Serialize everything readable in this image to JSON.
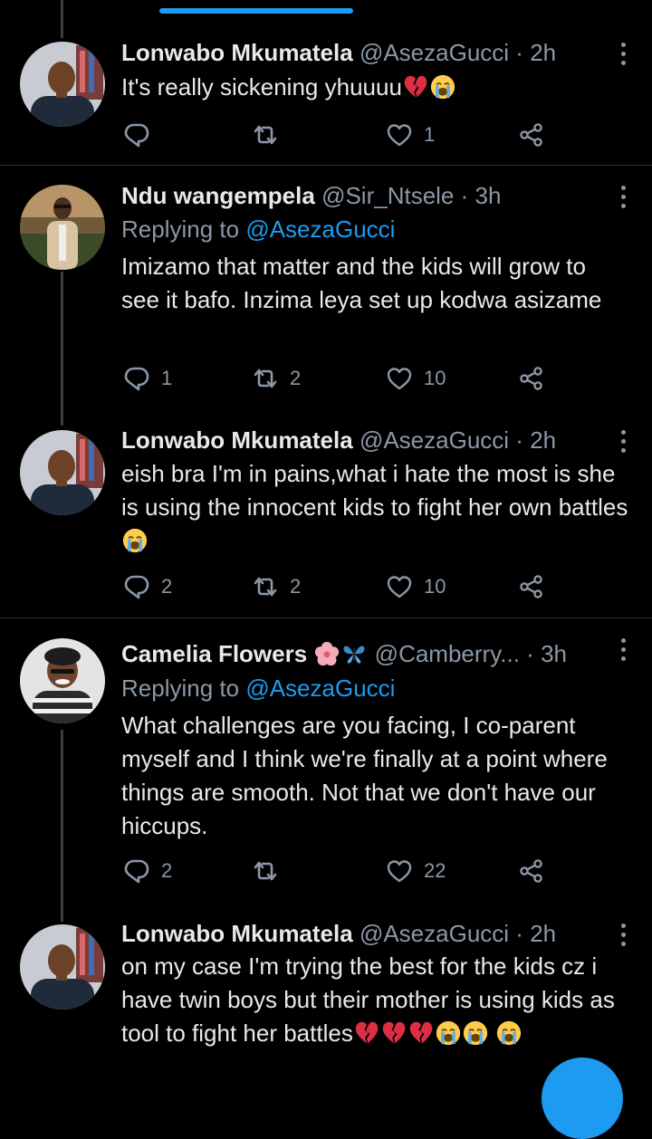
{
  "colors": {
    "background": "#000000",
    "text": "#e7e9ea",
    "secondary": "#8b98a5",
    "accent": "#1d9bf0",
    "divider": "#2f3336"
  },
  "tweets": [
    {
      "name": "Lonwabo Mkumatela",
      "handle": "@AsezaGucci",
      "separator": "·",
      "time": "2h",
      "replying_label": "",
      "replying_to": "",
      "text": "It's really sickening yhuuuu",
      "emojis": [
        "broken-heart",
        "crying-face"
      ],
      "replies": "",
      "retweets": "",
      "likes": "1"
    },
    {
      "name": "Ndu wangempela",
      "handle": "@Sir_Ntsele",
      "separator": "·",
      "time": "3h",
      "replying_label": "Replying to",
      "replying_to": "@AsezaGucci",
      "text": "Imizamo that matter and the kids will grow to see it bafo.  Inzima leya set up kodwa asizame",
      "emojis": [],
      "replies": "1",
      "retweets": "2",
      "likes": "10"
    },
    {
      "name": "Lonwabo Mkumatela",
      "handle": "@AsezaGucci",
      "separator": "·",
      "time": "2h",
      "replying_label": "",
      "replying_to": "",
      "text": "eish bra I'm in pains,what i hate the most is she is using the innocent kids to fight her own battles",
      "emojis": [
        "crying-face"
      ],
      "replies": "2",
      "retweets": "2",
      "likes": "10"
    },
    {
      "name": "Camelia Flowers",
      "name_emojis": [
        "hibiscus",
        "butterfly"
      ],
      "handle": "@Camberry...",
      "separator": "·",
      "time": "3h",
      "replying_label": "Replying to",
      "replying_to": "@AsezaGucci",
      "text": "What challenges are you facing, I co-parent myself and I think we're finally at a point where things are smooth. Not that we don't have our hiccups.",
      "emojis": [],
      "replies": "2",
      "retweets": "",
      "likes": "22"
    },
    {
      "name": "Lonwabo Mkumatela",
      "handle": "@AsezaGucci",
      "separator": "·",
      "time": "2h",
      "replying_label": "",
      "replying_to": "",
      "text": "on my case I'm trying the best for the kids cz i have twin boys but their mother is using kids as tool to fight her battles",
      "emojis": [
        "broken-heart",
        "broken-heart",
        "broken-heart",
        "crying-face",
        "crying-face",
        "crying-face"
      ],
      "replies": "",
      "retweets": "",
      "likes": ""
    }
  ]
}
